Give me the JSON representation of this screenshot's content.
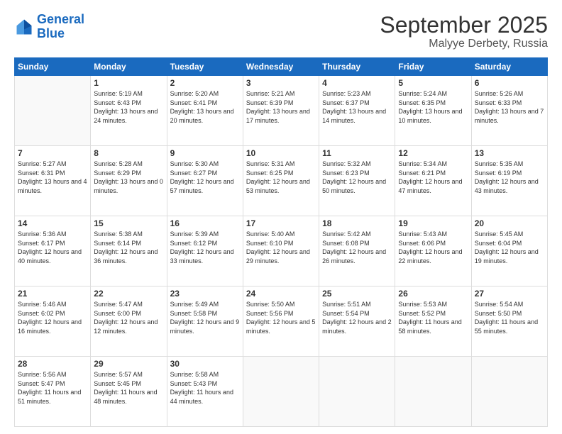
{
  "logo": {
    "line1": "General",
    "line2": "Blue"
  },
  "title": "September 2025",
  "subtitle": "Malyye Derbety, Russia",
  "weekdays": [
    "Sunday",
    "Monday",
    "Tuesday",
    "Wednesday",
    "Thursday",
    "Friday",
    "Saturday"
  ],
  "weeks": [
    [
      {
        "day": "",
        "sunrise": "",
        "sunset": "",
        "daylight": ""
      },
      {
        "day": "1",
        "sunrise": "5:19 AM",
        "sunset": "6:43 PM",
        "daylight": "13 hours and 24 minutes."
      },
      {
        "day": "2",
        "sunrise": "5:20 AM",
        "sunset": "6:41 PM",
        "daylight": "13 hours and 20 minutes."
      },
      {
        "day": "3",
        "sunrise": "5:21 AM",
        "sunset": "6:39 PM",
        "daylight": "13 hours and 17 minutes."
      },
      {
        "day": "4",
        "sunrise": "5:23 AM",
        "sunset": "6:37 PM",
        "daylight": "13 hours and 14 minutes."
      },
      {
        "day": "5",
        "sunrise": "5:24 AM",
        "sunset": "6:35 PM",
        "daylight": "13 hours and 10 minutes."
      },
      {
        "day": "6",
        "sunrise": "5:26 AM",
        "sunset": "6:33 PM",
        "daylight": "13 hours and 7 minutes."
      }
    ],
    [
      {
        "day": "7",
        "sunrise": "5:27 AM",
        "sunset": "6:31 PM",
        "daylight": "13 hours and 4 minutes."
      },
      {
        "day": "8",
        "sunrise": "5:28 AM",
        "sunset": "6:29 PM",
        "daylight": "13 hours and 0 minutes."
      },
      {
        "day": "9",
        "sunrise": "5:30 AM",
        "sunset": "6:27 PM",
        "daylight": "12 hours and 57 minutes."
      },
      {
        "day": "10",
        "sunrise": "5:31 AM",
        "sunset": "6:25 PM",
        "daylight": "12 hours and 53 minutes."
      },
      {
        "day": "11",
        "sunrise": "5:32 AM",
        "sunset": "6:23 PM",
        "daylight": "12 hours and 50 minutes."
      },
      {
        "day": "12",
        "sunrise": "5:34 AM",
        "sunset": "6:21 PM",
        "daylight": "12 hours and 47 minutes."
      },
      {
        "day": "13",
        "sunrise": "5:35 AM",
        "sunset": "6:19 PM",
        "daylight": "12 hours and 43 minutes."
      }
    ],
    [
      {
        "day": "14",
        "sunrise": "5:36 AM",
        "sunset": "6:17 PM",
        "daylight": "12 hours and 40 minutes."
      },
      {
        "day": "15",
        "sunrise": "5:38 AM",
        "sunset": "6:14 PM",
        "daylight": "12 hours and 36 minutes."
      },
      {
        "day": "16",
        "sunrise": "5:39 AM",
        "sunset": "6:12 PM",
        "daylight": "12 hours and 33 minutes."
      },
      {
        "day": "17",
        "sunrise": "5:40 AM",
        "sunset": "6:10 PM",
        "daylight": "12 hours and 29 minutes."
      },
      {
        "day": "18",
        "sunrise": "5:42 AM",
        "sunset": "6:08 PM",
        "daylight": "12 hours and 26 minutes."
      },
      {
        "day": "19",
        "sunrise": "5:43 AM",
        "sunset": "6:06 PM",
        "daylight": "12 hours and 22 minutes."
      },
      {
        "day": "20",
        "sunrise": "5:45 AM",
        "sunset": "6:04 PM",
        "daylight": "12 hours and 19 minutes."
      }
    ],
    [
      {
        "day": "21",
        "sunrise": "5:46 AM",
        "sunset": "6:02 PM",
        "daylight": "12 hours and 16 minutes."
      },
      {
        "day": "22",
        "sunrise": "5:47 AM",
        "sunset": "6:00 PM",
        "daylight": "12 hours and 12 minutes."
      },
      {
        "day": "23",
        "sunrise": "5:49 AM",
        "sunset": "5:58 PM",
        "daylight": "12 hours and 9 minutes."
      },
      {
        "day": "24",
        "sunrise": "5:50 AM",
        "sunset": "5:56 PM",
        "daylight": "12 hours and 5 minutes."
      },
      {
        "day": "25",
        "sunrise": "5:51 AM",
        "sunset": "5:54 PM",
        "daylight": "12 hours and 2 minutes."
      },
      {
        "day": "26",
        "sunrise": "5:53 AM",
        "sunset": "5:52 PM",
        "daylight": "11 hours and 58 minutes."
      },
      {
        "day": "27",
        "sunrise": "5:54 AM",
        "sunset": "5:50 PM",
        "daylight": "11 hours and 55 minutes."
      }
    ],
    [
      {
        "day": "28",
        "sunrise": "5:56 AM",
        "sunset": "5:47 PM",
        "daylight": "11 hours and 51 minutes."
      },
      {
        "day": "29",
        "sunrise": "5:57 AM",
        "sunset": "5:45 PM",
        "daylight": "11 hours and 48 minutes."
      },
      {
        "day": "30",
        "sunrise": "5:58 AM",
        "sunset": "5:43 PM",
        "daylight": "11 hours and 44 minutes."
      },
      {
        "day": "",
        "sunrise": "",
        "sunset": "",
        "daylight": ""
      },
      {
        "day": "",
        "sunrise": "",
        "sunset": "",
        "daylight": ""
      },
      {
        "day": "",
        "sunrise": "",
        "sunset": "",
        "daylight": ""
      },
      {
        "day": "",
        "sunrise": "",
        "sunset": "",
        "daylight": ""
      }
    ]
  ]
}
